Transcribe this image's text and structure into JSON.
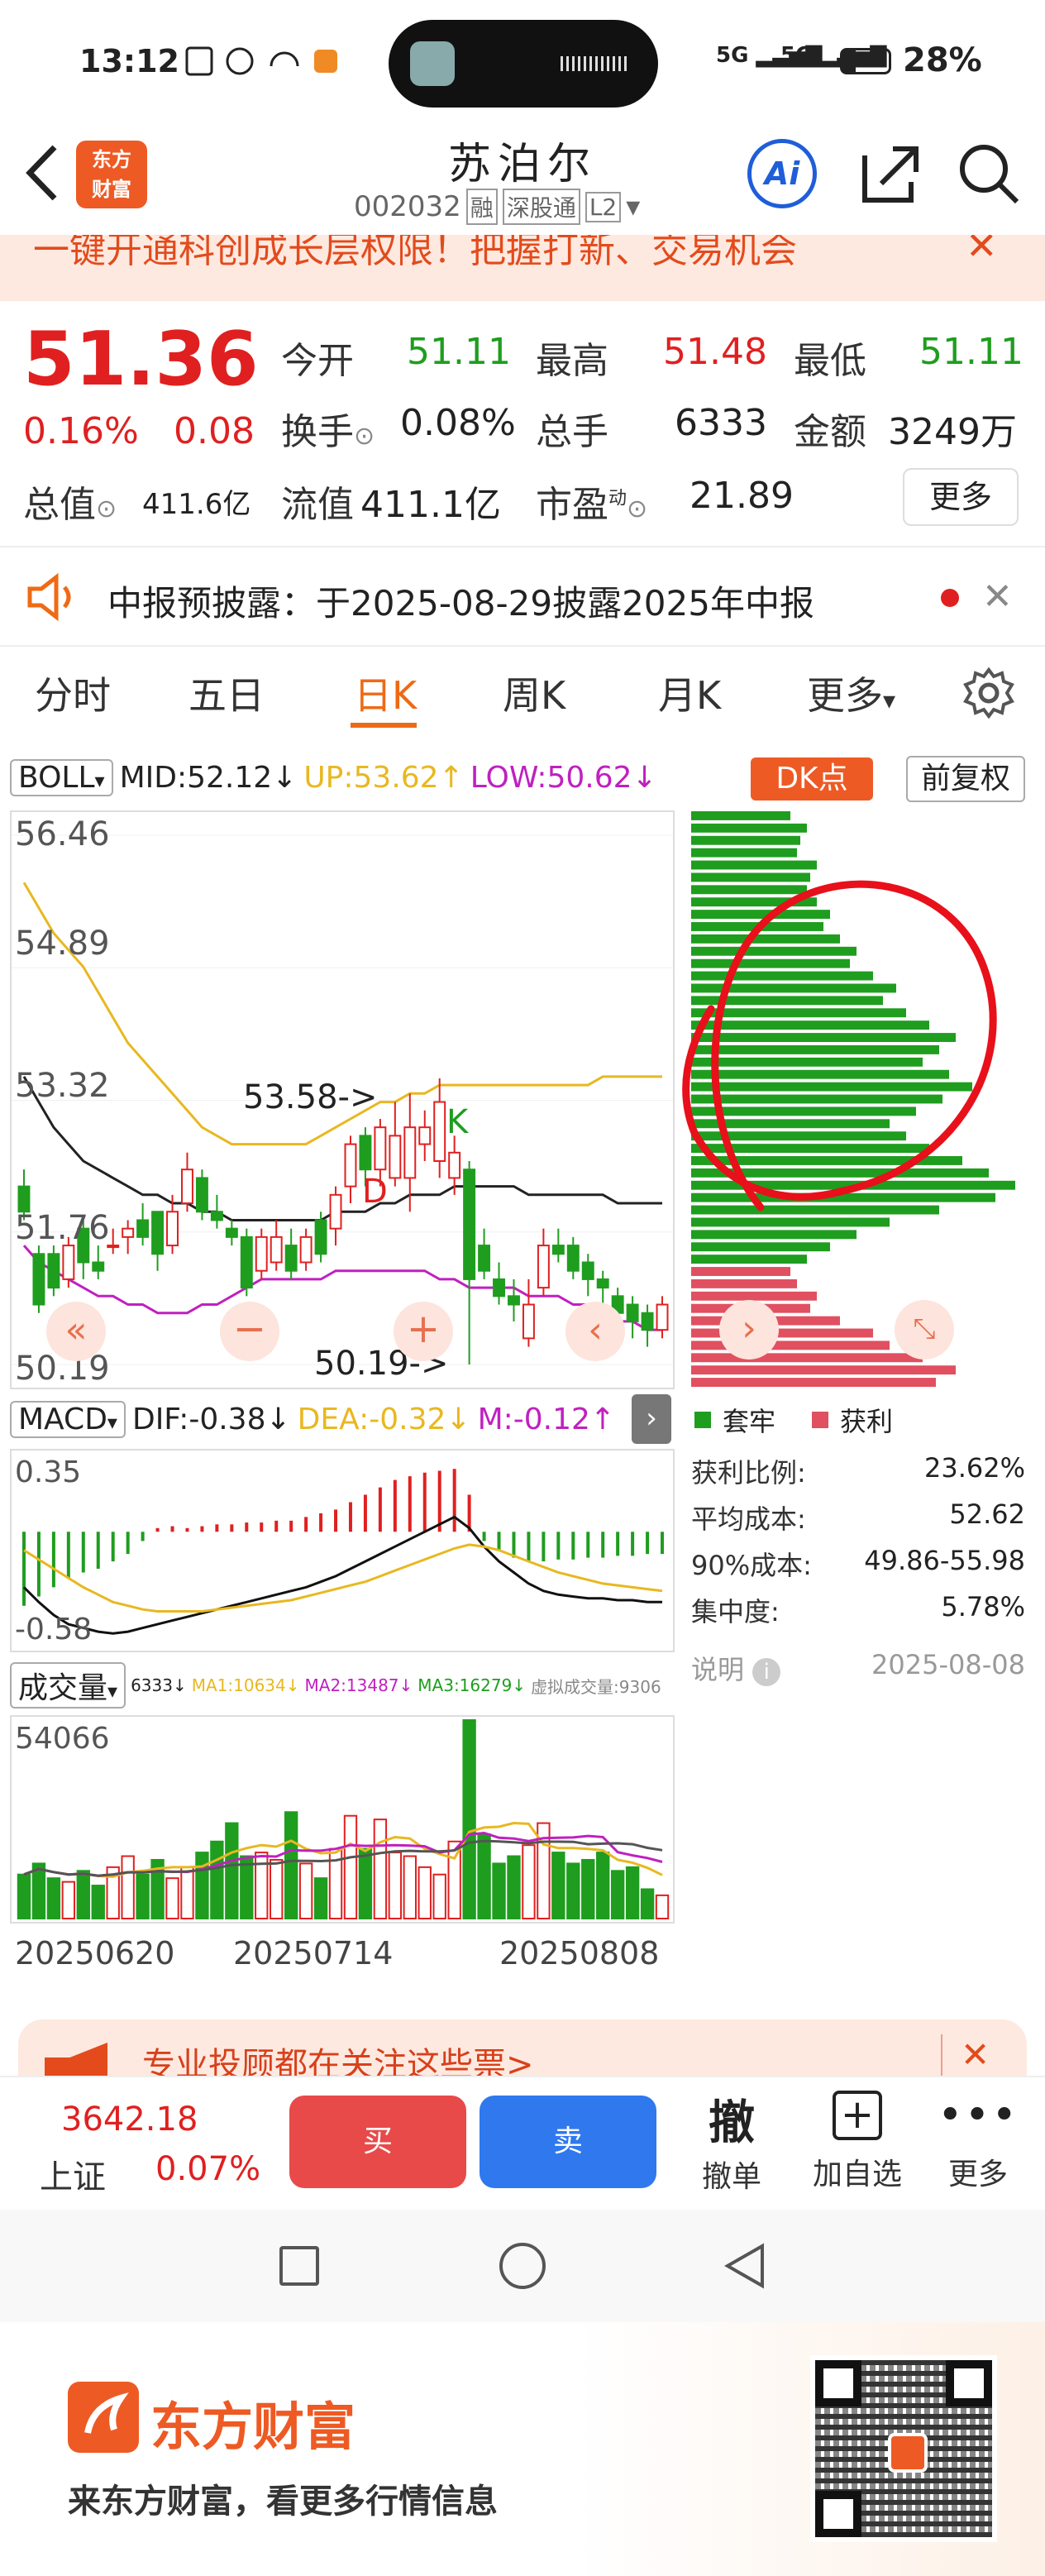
{
  "status_bar": {
    "time": "13:12",
    "signal1": "5G",
    "signal2": "5G",
    "battery": "28%"
  },
  "header": {
    "title": "苏泊尔",
    "code": "002032",
    "badge_margin": "融",
    "badge_connect": "深股通",
    "badge_level": "L2",
    "logo_text_line1": "东方",
    "logo_text_line2": "财富",
    "ai_label": "Ai"
  },
  "banner": {
    "text": "一键开通科创成长层权限！把握打新、交易机会"
  },
  "quote": {
    "price": "51.36",
    "pct": "0.16%",
    "chg": "0.08",
    "open_label": "今开",
    "open": "51.11",
    "high_label": "最高",
    "high": "51.48",
    "low_label": "最低",
    "low": "51.11",
    "turnover_label": "换手",
    "turnover": "0.08%",
    "vol_label": "总手",
    "vol": "6333",
    "amount_label": "金额",
    "amount": "3249万",
    "mcap_label": "总值",
    "mcap": "411.6亿",
    "float_label": "流值",
    "float": "411.1亿",
    "pe_label": "市盈",
    "pe_sup": "动",
    "pe": "21.89",
    "more": "更多"
  },
  "notice": {
    "text": "中报预披露：于2025-08-29披露2025年中报"
  },
  "tabs": [
    "分时",
    "五日",
    "日K",
    "周K",
    "月K",
    "更多"
  ],
  "active_tab": 2,
  "boll": {
    "label": "BOLL",
    "mid": "MID:52.12↓",
    "up": "UP:53.62↑",
    "low": "LOW:50.62↓",
    "dk_btn": "DK点",
    "adjust_btn": "前复权",
    "y_ticks": [
      "56.46",
      "54.89",
      "53.32",
      "51.76",
      "50.19"
    ],
    "high_ann": "53.58->",
    "low_ann": "50.19->",
    "mark_k": "K",
    "mark_d": "D"
  },
  "macd": {
    "label": "MACD",
    "dif": "DIF:-0.38↓",
    "dea": "DEA:-0.32↓",
    "m": "M:-0.12↑",
    "y_top": "0.35",
    "y_bot": "-0.58"
  },
  "volume": {
    "label": "成交量",
    "v": "6333↓",
    "ma1": "MA1:10634↓",
    "ma2": "MA2:13487↓",
    "ma3": "MA3:16279↓",
    "virt": "虚拟成交量:9306",
    "y_top": "54066",
    "dates": [
      "20250620",
      "20250714",
      "20250808"
    ]
  },
  "chips": {
    "legend_trap": "套牢",
    "legend_profit": "获利",
    "rows": [
      {
        "label": "获利比例:",
        "value": "23.62%"
      },
      {
        "label": "平均成本:",
        "value": "52.62"
      },
      {
        "label": "90%成本:",
        "value": "49.86-55.98"
      },
      {
        "label": "集中度:",
        "value": "5.78%"
      }
    ],
    "note_label": "说明",
    "note_date": "2025-08-08"
  },
  "promo": {
    "text": "专业投顾都在关注这些票>"
  },
  "bottom": {
    "index_value": "3642.18",
    "index_name": "上证",
    "index_pct": "0.07%",
    "buy": "买",
    "sell": "卖",
    "cancel_icon": "撤",
    "cancel": "撤单",
    "add": "加自选",
    "more": "更多"
  },
  "footer": {
    "brand": "东方财富",
    "slogan": "来东方财富，看更多行情信息"
  },
  "colors": {
    "up": "#e02020",
    "down": "#1f9d1f",
    "accent": "#ee6a14",
    "boll_up": "#e8b820",
    "boll_low": "#c020c0"
  },
  "candles": [
    {
      "o": 52.3,
      "c": 52.0,
      "h": 52.5,
      "l": 51.9
    },
    {
      "o": 51.5,
      "c": 50.9,
      "h": 51.6,
      "l": 50.8
    },
    {
      "o": 51.5,
      "c": 51.1,
      "h": 51.6,
      "l": 51.0
    },
    {
      "o": 51.2,
      "c": 51.6,
      "h": 51.7,
      "l": 51.1
    },
    {
      "o": 51.8,
      "c": 51.4,
      "h": 51.9,
      "l": 51.2
    },
    {
      "o": 51.4,
      "c": 51.3,
      "h": 51.6,
      "l": 51.2
    },
    {
      "o": 51.6,
      "c": 51.6,
      "h": 51.8,
      "l": 51.5
    },
    {
      "o": 51.7,
      "c": 51.8,
      "h": 51.9,
      "l": 51.5
    },
    {
      "o": 51.9,
      "c": 51.7,
      "h": 52.1,
      "l": 51.6
    },
    {
      "o": 52.0,
      "c": 51.5,
      "h": 52.0,
      "l": 51.3
    },
    {
      "o": 51.6,
      "c": 52.0,
      "h": 52.2,
      "l": 51.5
    },
    {
      "o": 52.1,
      "c": 52.5,
      "h": 52.7,
      "l": 52.0
    },
    {
      "o": 52.4,
      "c": 52.0,
      "h": 52.5,
      "l": 51.9
    },
    {
      "o": 52.0,
      "c": 51.9,
      "h": 52.2,
      "l": 51.8
    },
    {
      "o": 51.8,
      "c": 51.7,
      "h": 51.9,
      "l": 51.6
    },
    {
      "o": 51.7,
      "c": 51.1,
      "h": 51.8,
      "l": 51.0
    },
    {
      "o": 51.3,
      "c": 51.7,
      "h": 51.8,
      "l": 51.2
    },
    {
      "o": 51.4,
      "c": 51.7,
      "h": 51.9,
      "l": 51.3
    },
    {
      "o": 51.6,
      "c": 51.3,
      "h": 51.8,
      "l": 51.2
    },
    {
      "o": 51.4,
      "c": 51.7,
      "h": 51.8,
      "l": 51.3
    },
    {
      "o": 51.9,
      "c": 51.5,
      "h": 52.0,
      "l": 51.4
    },
    {
      "o": 51.8,
      "c": 52.2,
      "h": 52.3,
      "l": 51.6
    },
    {
      "o": 52.3,
      "c": 52.8,
      "h": 52.9,
      "l": 52.1
    },
    {
      "o": 52.9,
      "c": 52.5,
      "h": 53.0,
      "l": 52.3
    },
    {
      "o": 52.5,
      "c": 53.0,
      "h": 53.1,
      "l": 52.3
    },
    {
      "o": 52.4,
      "c": 52.9,
      "h": 53.3,
      "l": 52.3
    },
    {
      "o": 52.4,
      "c": 53.0,
      "h": 53.4,
      "l": 52.0
    },
    {
      "o": 52.8,
      "c": 53.0,
      "h": 53.2,
      "l": 52.6
    },
    {
      "o": 52.6,
      "c": 53.3,
      "h": 53.58,
      "l": 52.4
    },
    {
      "o": 52.4,
      "c": 52.7,
      "h": 52.9,
      "l": 52.2
    },
    {
      "o": 52.5,
      "c": 51.2,
      "h": 52.6,
      "l": 50.19
    },
    {
      "o": 51.6,
      "c": 51.3,
      "h": 51.8,
      "l": 51.2
    },
    {
      "o": 51.2,
      "c": 51.0,
      "h": 51.4,
      "l": 50.9
    },
    {
      "o": 51.0,
      "c": 50.9,
      "h": 51.2,
      "l": 50.7
    },
    {
      "o": 50.5,
      "c": 50.9,
      "h": 51.2,
      "l": 50.4
    },
    {
      "o": 51.1,
      "c": 51.6,
      "h": 51.8,
      "l": 51.0
    },
    {
      "o": 51.6,
      "c": 51.5,
      "h": 51.8,
      "l": 51.4
    },
    {
      "o": 51.6,
      "c": 51.3,
      "h": 51.7,
      "l": 51.2
    },
    {
      "o": 51.4,
      "c": 51.2,
      "h": 51.5,
      "l": 51.0
    },
    {
      "o": 51.2,
      "c": 51.1,
      "h": 51.3,
      "l": 50.9
    },
    {
      "o": 51.0,
      "c": 50.8,
      "h": 51.1,
      "l": 50.6
    },
    {
      "o": 50.9,
      "c": 50.7,
      "h": 51.0,
      "l": 50.5
    },
    {
      "o": 50.8,
      "c": 50.6,
      "h": 50.9,
      "l": 50.4
    },
    {
      "o": 50.6,
      "c": 50.9,
      "h": 51.0,
      "l": 50.5
    }
  ],
  "boll_lines": {
    "up": [
      55.9,
      55.6,
      55.3,
      55.1,
      54.9,
      54.6,
      54.3,
      54.0,
      53.8,
      53.6,
      53.4,
      53.2,
      53.0,
      52.9,
      52.8,
      52.8,
      52.8,
      52.8,
      52.8,
      52.8,
      52.9,
      53.0,
      53.1,
      53.2,
      53.3,
      53.3,
      53.4,
      53.4,
      53.5,
      53.5,
      53.5,
      53.5,
      53.5,
      53.5,
      53.5,
      53.5,
      53.5,
      53.5,
      53.5,
      53.6,
      53.6,
      53.6,
      53.6,
      53.6
    ],
    "mid": [
      53.6,
      53.3,
      53.0,
      52.8,
      52.6,
      52.5,
      52.4,
      52.3,
      52.2,
      52.2,
      52.1,
      52.1,
      52.0,
      52.0,
      51.9,
      51.9,
      51.9,
      51.9,
      51.9,
      51.9,
      51.9,
      52.0,
      52.0,
      52.0,
      52.1,
      52.1,
      52.2,
      52.2,
      52.2,
      52.3,
      52.3,
      52.3,
      52.3,
      52.3,
      52.2,
      52.2,
      52.2,
      52.2,
      52.2,
      52.2,
      52.1,
      52.1,
      52.1,
      52.1
    ],
    "low": [
      51.6,
      51.4,
      51.3,
      51.2,
      51.1,
      51.0,
      51.0,
      50.9,
      50.9,
      50.8,
      50.8,
      50.8,
      50.9,
      50.9,
      51.0,
      51.1,
      51.2,
      51.2,
      51.2,
      51.2,
      51.2,
      51.3,
      51.3,
      51.3,
      51.3,
      51.3,
      51.3,
      51.3,
      51.2,
      51.2,
      51.1,
      51.1,
      51.1,
      51.1,
      51.0,
      51.0,
      51.0,
      50.9,
      50.9,
      50.8,
      50.7,
      50.7,
      50.6,
      50.6
    ]
  },
  "macd_bars": [
    -0.4,
    -0.35,
    -0.3,
    -0.25,
    -0.22,
    -0.2,
    -0.16,
    -0.12,
    -0.05,
    0.02,
    0.03,
    0.02,
    0.03,
    0.04,
    0.04,
    0.05,
    0.05,
    0.06,
    0.06,
    0.08,
    0.1,
    0.12,
    0.16,
    0.2,
    0.24,
    0.28,
    0.3,
    0.32,
    0.33,
    0.34,
    0.2,
    -0.05,
    -0.1,
    -0.14,
    -0.16,
    -0.16,
    -0.15,
    -0.15,
    -0.14,
    -0.14,
    -0.13,
    -0.13,
    -0.12,
    -0.12
  ],
  "macd_dif": [
    -0.3,
    -0.38,
    -0.45,
    -0.5,
    -0.52,
    -0.54,
    -0.55,
    -0.54,
    -0.52,
    -0.5,
    -0.48,
    -0.46,
    -0.44,
    -0.42,
    -0.4,
    -0.38,
    -0.36,
    -0.34,
    -0.32,
    -0.3,
    -0.27,
    -0.24,
    -0.2,
    -0.16,
    -0.12,
    -0.08,
    -0.04,
    0.0,
    0.04,
    0.08,
    0.02,
    -0.08,
    -0.16,
    -0.22,
    -0.28,
    -0.32,
    -0.34,
    -0.35,
    -0.36,
    -0.36,
    -0.37,
    -0.37,
    -0.38,
    -0.38
  ],
  "macd_dea": [
    -0.1,
    -0.15,
    -0.2,
    -0.25,
    -0.3,
    -0.34,
    -0.38,
    -0.4,
    -0.42,
    -0.43,
    -0.43,
    -0.43,
    -0.43,
    -0.42,
    -0.41,
    -0.4,
    -0.39,
    -0.38,
    -0.37,
    -0.35,
    -0.33,
    -0.31,
    -0.29,
    -0.27,
    -0.24,
    -0.21,
    -0.18,
    -0.15,
    -0.12,
    -0.09,
    -0.07,
    -0.08,
    -0.1,
    -0.13,
    -0.16,
    -0.19,
    -0.22,
    -0.24,
    -0.26,
    -0.28,
    -0.29,
    -0.3,
    -0.31,
    -0.32
  ],
  "volumes": [
    12000,
    15000,
    11000,
    10000,
    13000,
    9000,
    14000,
    17000,
    12000,
    16000,
    11000,
    14000,
    18000,
    21000,
    26000,
    17000,
    18000,
    16000,
    29000,
    15000,
    11000,
    19000,
    28000,
    19000,
    27000,
    18000,
    17000,
    14000,
    12000,
    21000,
    54066,
    23000,
    15000,
    17000,
    20000,
    26000,
    18000,
    15000,
    16000,
    18000,
    13000,
    14000,
    8000,
    6333
  ],
  "chip_bars": [
    {
      "w": 0.3,
      "p": false
    },
    {
      "w": 0.35,
      "p": false
    },
    {
      "w": 0.33,
      "p": false
    },
    {
      "w": 0.32,
      "p": false
    },
    {
      "w": 0.38,
      "p": false
    },
    {
      "w": 0.36,
      "p": false
    },
    {
      "w": 0.35,
      "p": false
    },
    {
      "w": 0.38,
      "p": false
    },
    {
      "w": 0.42,
      "p": false
    },
    {
      "w": 0.4,
      "p": false
    },
    {
      "w": 0.45,
      "p": false
    },
    {
      "w": 0.5,
      "p": false
    },
    {
      "w": 0.48,
      "p": false
    },
    {
      "w": 0.55,
      "p": false
    },
    {
      "w": 0.62,
      "p": false
    },
    {
      "w": 0.58,
      "p": false
    },
    {
      "w": 0.65,
      "p": false
    },
    {
      "w": 0.72,
      "p": false
    },
    {
      "w": 0.8,
      "p": false
    },
    {
      "w": 0.75,
      "p": false
    },
    {
      "w": 0.7,
      "p": false
    },
    {
      "w": 0.78,
      "p": false
    },
    {
      "w": 0.85,
      "p": false
    },
    {
      "w": 0.76,
      "p": false
    },
    {
      "w": 0.68,
      "p": false
    },
    {
      "w": 0.6,
      "p": false
    },
    {
      "w": 0.65,
      "p": false
    },
    {
      "w": 0.72,
      "p": false
    },
    {
      "w": 0.82,
      "p": false
    },
    {
      "w": 0.9,
      "p": false
    },
    {
      "w": 0.98,
      "p": false
    },
    {
      "w": 0.92,
      "p": false
    },
    {
      "w": 0.75,
      "p": false
    },
    {
      "w": 0.6,
      "p": false
    },
    {
      "w": 0.5,
      "p": false
    },
    {
      "w": 0.42,
      "p": false
    },
    {
      "w": 0.35,
      "p": false
    },
    {
      "w": 0.3,
      "p": true
    },
    {
      "w": 0.32,
      "p": true
    },
    {
      "w": 0.38,
      "p": true
    },
    {
      "w": 0.36,
      "p": true
    },
    {
      "w": 0.45,
      "p": true
    },
    {
      "w": 0.55,
      "p": true
    },
    {
      "w": 0.6,
      "p": true
    },
    {
      "w": 0.7,
      "p": true
    },
    {
      "w": 0.8,
      "p": true
    },
    {
      "w": 0.74,
      "p": true
    }
  ]
}
